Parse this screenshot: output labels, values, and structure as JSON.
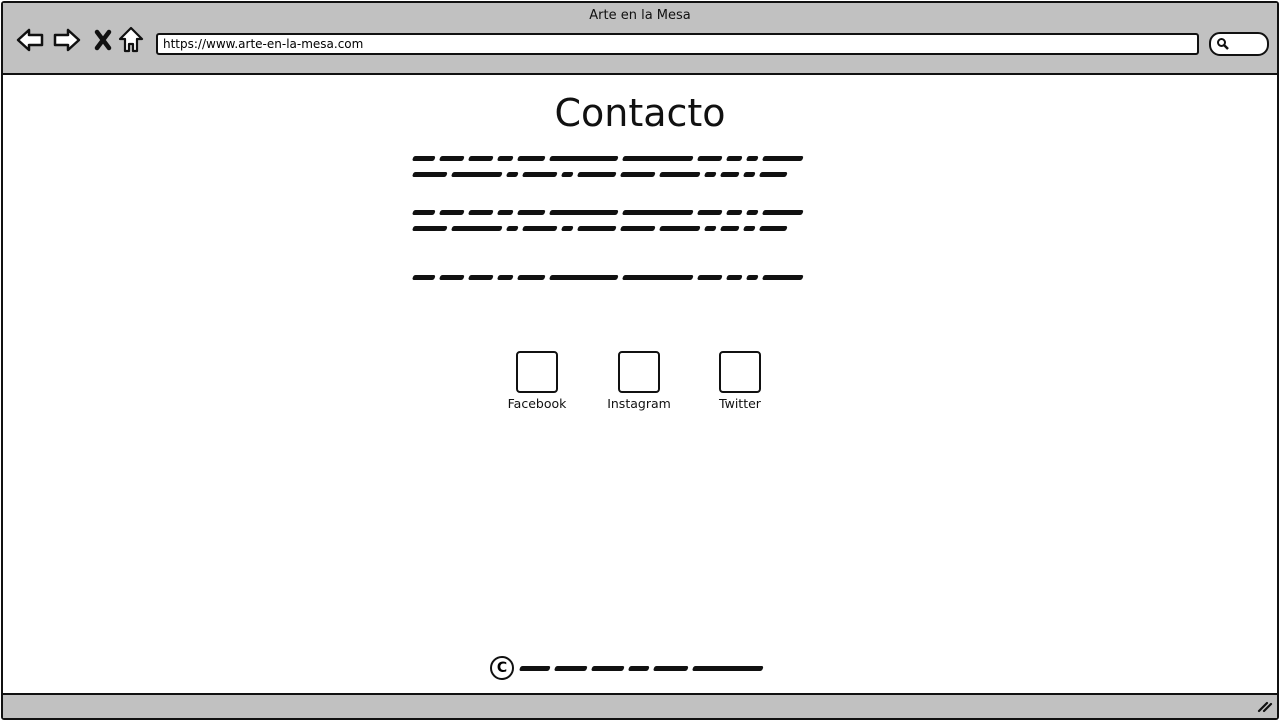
{
  "browser": {
    "title": "Arte en la Mesa",
    "url": "https://www.arte-en-la-mesa.com",
    "icons": [
      "back-arrow-icon",
      "forward-arrow-icon",
      "close-icon",
      "home-icon",
      "search-icon",
      "resize-grip-icon"
    ]
  },
  "page": {
    "heading": "Contacto",
    "social": [
      {
        "label": "Facebook"
      },
      {
        "label": "Instagram"
      },
      {
        "label": "Twitter"
      }
    ],
    "footer": {
      "icon": "copyright-icon"
    }
  },
  "colors": {
    "chrome": "#c1c1c1",
    "ink": "#111111",
    "background": "#ffffff"
  }
}
